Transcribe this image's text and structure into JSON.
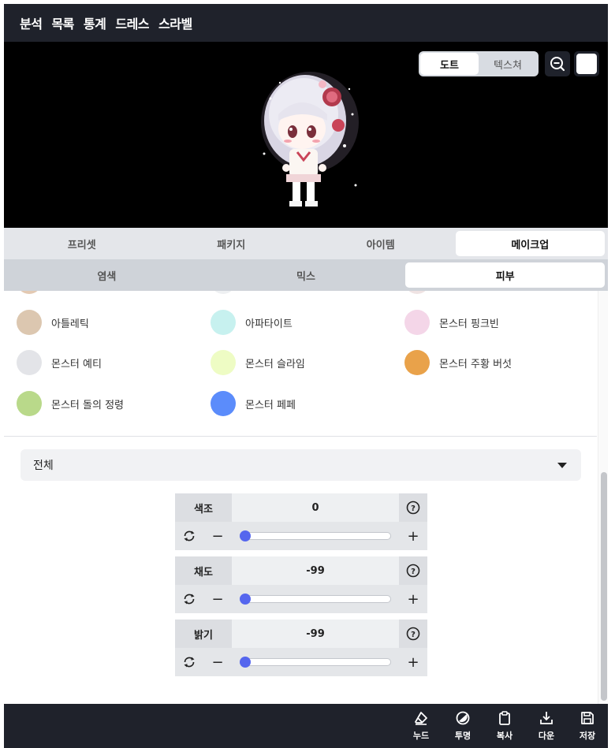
{
  "topnav": {
    "items": [
      "분석",
      "목록",
      "통계",
      "드레스",
      "스라벨"
    ]
  },
  "preview": {
    "view_toggle": {
      "options": [
        "도트",
        "텍스쳐"
      ],
      "selected": "도트"
    },
    "zoom_icon": "zoom-out-icon",
    "background_color": "#ffffff"
  },
  "main_tabs": {
    "items": [
      "프리셋",
      "패키지",
      "아이템",
      "메이크업"
    ],
    "selected": "메이크업"
  },
  "sub_tabs": {
    "items": [
      "염색",
      "믹스",
      "피부"
    ],
    "selected": "피부"
  },
  "skins": [
    {
      "label": "아틀레틱",
      "color": "#dcc7b0"
    },
    {
      "label": "아파타이트",
      "color": "#c7f1ef"
    },
    {
      "label": "몬스터 핑크빈",
      "color": "#f4d6e8"
    },
    {
      "label": "몬스터 예티",
      "color": "#e3e4e8"
    },
    {
      "label": "몬스터 슬라임",
      "color": "#eefcc4"
    },
    {
      "label": "몬스터 주황 버섯",
      "color": "#e9a24a"
    },
    {
      "label": "몬스터 돌의 정령",
      "color": "#b9d98a"
    },
    {
      "label": "몬스터 페페",
      "color": "#5b8cfb"
    }
  ],
  "filter": {
    "selected": "전체"
  },
  "adjustments": [
    {
      "label": "색조",
      "value": "0",
      "fraction": 0.0
    },
    {
      "label": "채도",
      "value": "-99",
      "fraction": 0.0
    },
    {
      "label": "밝기",
      "value": "-99",
      "fraction": 0.0
    }
  ],
  "toolbar": {
    "items": [
      {
        "label": "누드",
        "icon": "eraser-icon"
      },
      {
        "label": "투명",
        "icon": "transparency-icon"
      },
      {
        "label": "복사",
        "icon": "clipboard-icon"
      },
      {
        "label": "다운",
        "icon": "download-icon"
      },
      {
        "label": "저장",
        "icon": "save-icon"
      }
    ]
  }
}
